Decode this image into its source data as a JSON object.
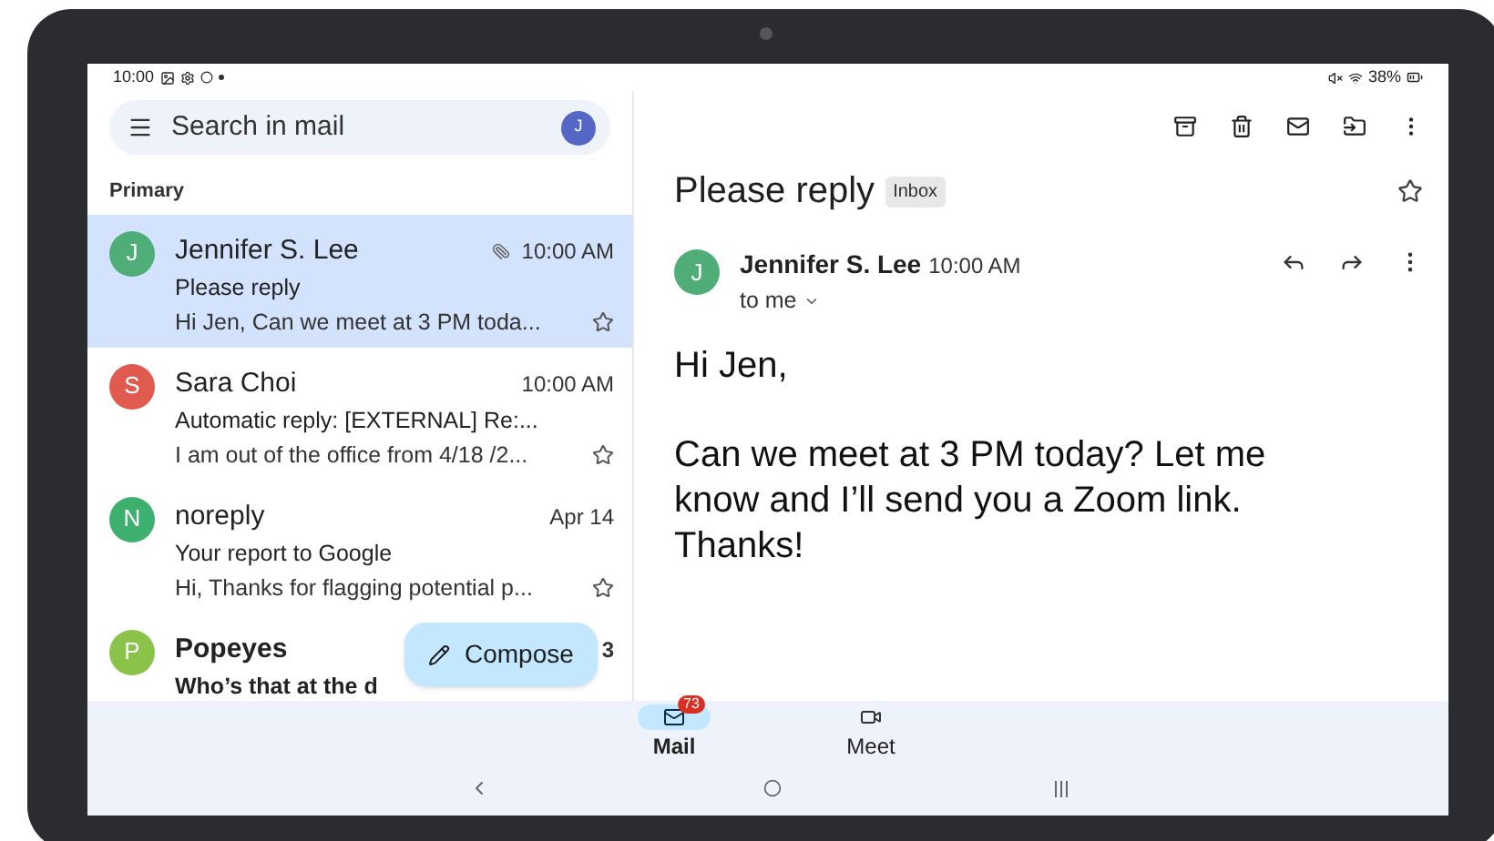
{
  "status_bar": {
    "time": "10:00",
    "battery": "38%"
  },
  "search": {
    "placeholder": "Search in mail",
    "avatar": "J"
  },
  "section": "Primary",
  "emails": [
    {
      "avatar": "J",
      "color": "#4fae78",
      "sender": "Jennifer S. Lee",
      "time": "10:00 AM",
      "subject": "Please reply",
      "snippet": "Hi Jen, Can we meet at 3 PM toda...",
      "selected": true,
      "unread": false,
      "attachment": true,
      "starred": false
    },
    {
      "avatar": "S",
      "color": "#e05a4f",
      "sender": "Sara Choi",
      "time": "10:00 AM",
      "subject": "Automatic reply: [EXTERNAL] Re:...",
      "snippet": "I am out of the office from 4/18 /2...",
      "selected": false,
      "unread": false,
      "attachment": false,
      "starred": false
    },
    {
      "avatar": "N",
      "color": "#3daf6e",
      "sender": "noreply",
      "time": "Apr 14",
      "subject": "Your report to Google",
      "snippet": "Hi, Thanks for flagging potential p...",
      "selected": false,
      "unread": false,
      "attachment": false,
      "starred": false
    },
    {
      "avatar": "P",
      "color": "#8bc34a",
      "sender": "Popeyes",
      "time": "3",
      "subject": "Who’s that at the d",
      "selected": false,
      "unread": true,
      "attachment": false
    }
  ],
  "compose": {
    "label": "Compose"
  },
  "detail": {
    "subject": "Please reply",
    "label": "Inbox",
    "starred": false,
    "sender": "Jennifer S. Lee",
    "avatar": "J",
    "time": "10:00 AM",
    "recipient": "to me",
    "body": [
      "Hi Jen,",
      "Can we meet at 3 PM today? Let me know and I’ll send you a Zoom link. Thanks!"
    ]
  },
  "nav": [
    {
      "kind": "mail",
      "label": "Mail",
      "badge": "73",
      "selected": true
    },
    {
      "kind": "meet",
      "label": "Meet",
      "selected": false
    }
  ]
}
